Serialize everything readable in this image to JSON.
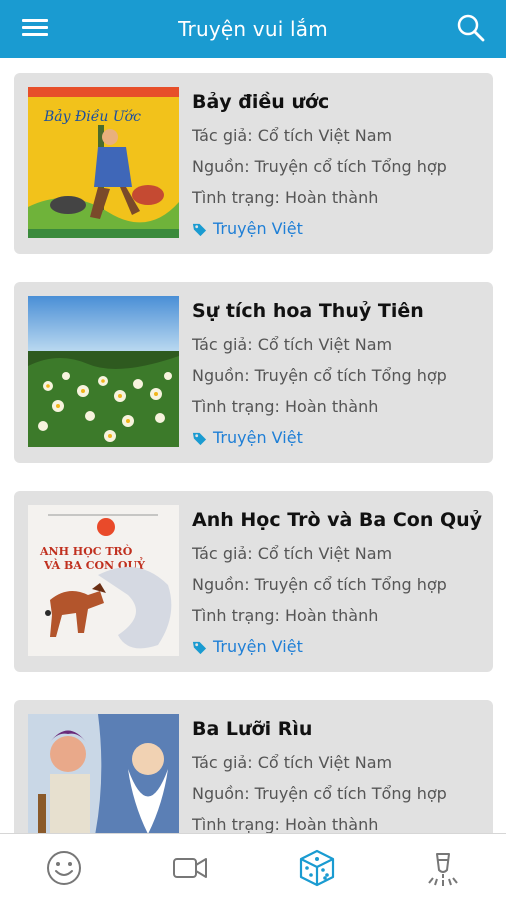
{
  "app": {
    "title": "Truyện vui lắm"
  },
  "icons": {
    "menu": "menu-icon",
    "search": "search-icon",
    "tag": "tag-icon"
  },
  "colors": {
    "header": "#1a9bd1",
    "card_bg": "#e1e1e1",
    "tag_text": "#1f7fd6",
    "active_tab": "#1a9bd1",
    "inactive_tab": "#777777"
  },
  "stories": [
    {
      "title": "Bảy điều ước",
      "author": "Tác giả: Cổ tích Việt Nam",
      "source": "Nguồn: Truyện cổ tích Tổng hợp",
      "status": "Tình trạng: Hoàn thành",
      "tag": "Truyện Việt",
      "cover_text": "Bảy Điều Ước"
    },
    {
      "title": "Sự tích hoa Thuỷ Tiên",
      "author": "Tác giả: Cổ tích Việt Nam",
      "source": "Nguồn: Truyện cổ tích Tổng hợp",
      "status": "Tình trạng: Hoàn thành",
      "tag": "Truyện Việt"
    },
    {
      "title": "Anh Học Trò và Ba Con Quỷ",
      "author": "Tác giả: Cổ tích Việt Nam",
      "source": "Nguồn: Truyện cổ tích Tổng hợp",
      "status": "Tình trạng: Hoàn thành",
      "tag": "Truyện Việt",
      "cover_text_1": "ANH HỌC TRÒ",
      "cover_text_2": "VÀ BA CON QUỶ"
    },
    {
      "title": "Ba Lưỡi Rìu",
      "author": "Tác giả: Cổ tích Việt Nam",
      "source": "Nguồn: Truyện cổ tích Tổng hợp",
      "status": "Tình trạng: Hoàn thành"
    }
  ],
  "bottom_nav": [
    {
      "icon": "smiley-icon",
      "active": false
    },
    {
      "icon": "video-camera-icon",
      "active": false
    },
    {
      "icon": "dice-icon",
      "active": true
    },
    {
      "icon": "flashlight-icon",
      "active": false
    }
  ]
}
